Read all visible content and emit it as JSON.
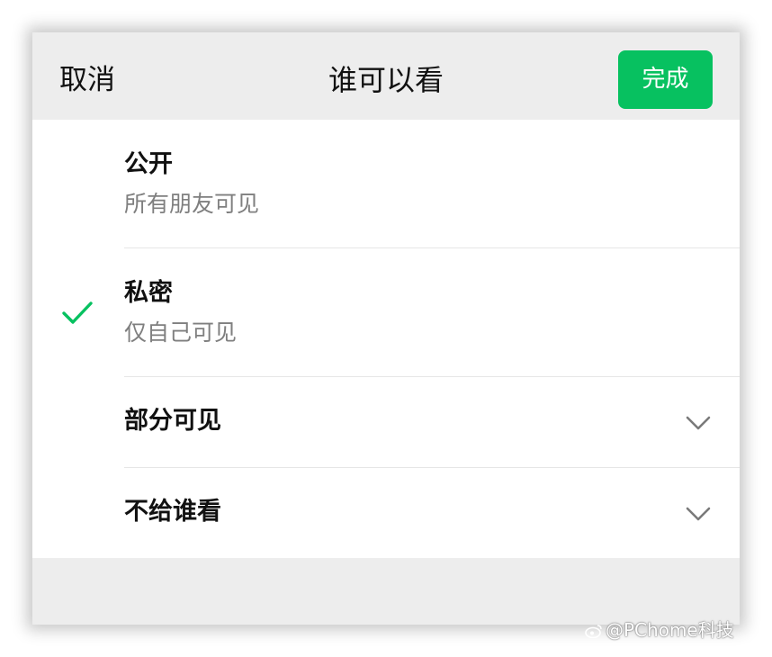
{
  "header": {
    "cancel_label": "取消",
    "title": "谁可以看",
    "done_label": "完成"
  },
  "options": [
    {
      "label": "公开",
      "desc": "所有朋友可见",
      "selected": false
    },
    {
      "label": "私密",
      "desc": "仅自己可见",
      "selected": true
    },
    {
      "label": "部分可见",
      "expandable": true
    },
    {
      "label": "不给谁看",
      "expandable": true
    }
  ],
  "icons": {
    "check": "check-icon",
    "expand": "chevron-down-icon",
    "watermark_logo": "weibo-icon"
  },
  "watermark": {
    "text": "@PChome科技"
  },
  "colors": {
    "accent": "#07c160",
    "header_bg": "#ededed",
    "list_bg": "#ffffff",
    "secondary_text": "#7f7f7f",
    "chevron": "#7a7a7a"
  }
}
